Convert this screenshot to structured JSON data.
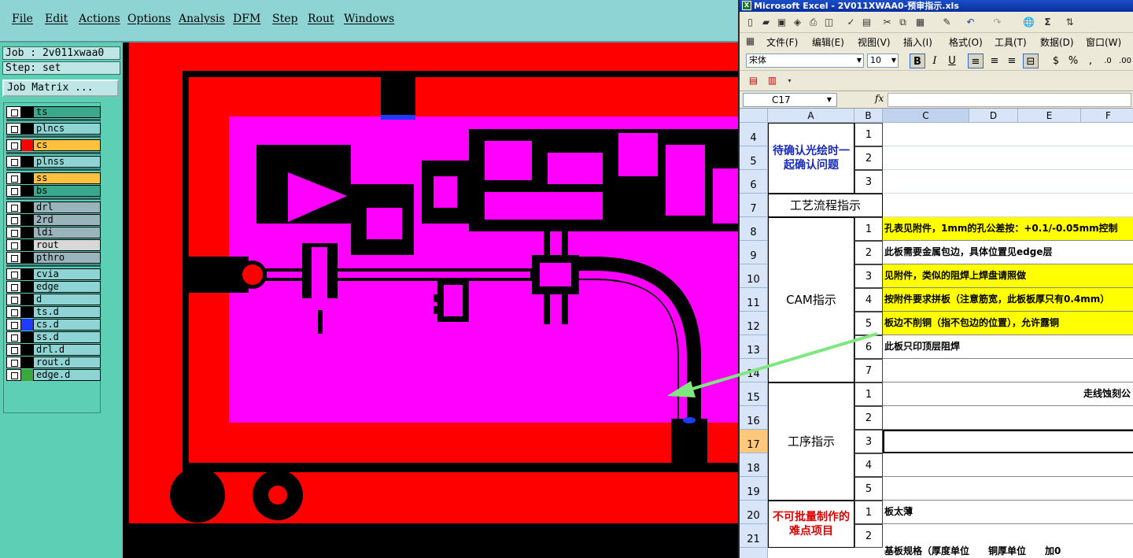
{
  "cam": {
    "menu": [
      "File",
      "Edit",
      "Actions",
      "Options",
      "Analysis",
      "DFM",
      "Step",
      "Rout",
      "Windows"
    ],
    "job_label": "Job : 2v011xwaa0",
    "step_label": "Step: set",
    "job_matrix_button": "Job Matrix ...",
    "layers": [
      {
        "name": "ts",
        "color": "#000000",
        "bg": "#3aa88a"
      },
      {
        "name": "plncs",
        "color": "#000000",
        "bg": "#8fd4d4"
      },
      {
        "name": "cs",
        "color": "#ff0000",
        "bg": "#ffc040"
      },
      {
        "name": "plnss",
        "color": "#000000",
        "bg": "#8fd4d4"
      },
      {
        "name": "ss",
        "color": "#000000",
        "bg": "#ffc040"
      },
      {
        "name": "bs",
        "color": "#000000",
        "bg": "#3aa88a"
      },
      {
        "name": "drl",
        "color": "#000000",
        "bg": "#9ab4bc"
      },
      {
        "name": "2rd",
        "color": "#000000",
        "bg": "#9ab4bc"
      },
      {
        "name": "ldi",
        "color": "#000000",
        "bg": "#9ab4bc"
      },
      {
        "name": "rout",
        "color": "#000000",
        "bg": "#d8d8d8"
      },
      {
        "name": "pthro",
        "color": "#000000",
        "bg": "#9ab4bc"
      },
      {
        "name": "cvia",
        "color": "#000000",
        "bg": "#8fd4d4"
      },
      {
        "name": "edge",
        "color": "#000000",
        "bg": "#8fd4d4"
      },
      {
        "name": "d",
        "color": "#000000",
        "bg": "#8fd4d4"
      },
      {
        "name": "ts.d",
        "color": "#000000",
        "bg": "#8fd4d4"
      },
      {
        "name": "cs.d",
        "color": "#1e3cff",
        "bg": "#8fd4d4"
      },
      {
        "name": "ss.d",
        "color": "#000000",
        "bg": "#8fd4d4"
      },
      {
        "name": "drl.d",
        "color": "#000000",
        "bg": "#8fd4d4"
      },
      {
        "name": "rout.d",
        "color": "#000000",
        "bg": "#8fd4d4"
      },
      {
        "name": "edge.d",
        "color": "#3aa83a",
        "bg": "#8fd4d4"
      }
    ]
  },
  "excel": {
    "title": "Microsoft Excel - 2V011XWAA0-预审指示.xls",
    "menu": [
      "文件(F)",
      "编辑(E)",
      "视图(V)",
      "插入(I)",
      "格式(O)",
      "工具(T)",
      "数据(D)",
      "窗口(W)"
    ],
    "font_name": "宋体",
    "font_size": "10",
    "name_box": "C17",
    "fx": "fx",
    "columns": [
      "A",
      "B",
      "C",
      "D",
      "E",
      "F"
    ],
    "rows": [
      "4",
      "5",
      "6",
      "7",
      "8",
      "9",
      "10",
      "11",
      "12",
      "13",
      "14",
      "15",
      "16",
      "17",
      "18",
      "19",
      "20",
      "21"
    ],
    "sections": {
      "confirm": "待确认光绘时一起确认问题",
      "process_flow": "工艺流程指示",
      "cam": "CAM指示",
      "procedure": "工序指示",
      "difficult": "不可批量制作的难点项目"
    },
    "confirm_nums": [
      "1",
      "2",
      "3"
    ],
    "cam_items": [
      {
        "n": "1",
        "text": "孔表见附件，1mm的孔公差按：+0.1/-0.05mm控制",
        "yellow": true
      },
      {
        "n": "2",
        "text": "此板需要金属包边，具体位置见edge层",
        "yellow": false
      },
      {
        "n": "3",
        "text": "见附件，类似的阻焊上焊盘请照做",
        "yellow": true
      },
      {
        "n": "4",
        "text": "按附件要求拼板（注意筋宽，此板板厚只有0.4mm）",
        "yellow": true
      },
      {
        "n": "5",
        "text": "板边不削铜（指不包边的位置），允许露铜",
        "yellow": true
      },
      {
        "n": "6",
        "text": "此板只印顶层阻焊",
        "yellow": false
      },
      {
        "n": "7",
        "text": "",
        "yellow": false
      }
    ],
    "procedure_items": [
      {
        "n": "1",
        "text": "走线蚀刻公"
      },
      {
        "n": "2",
        "text": ""
      },
      {
        "n": "3",
        "text": ""
      },
      {
        "n": "4",
        "text": ""
      },
      {
        "n": "5",
        "text": ""
      }
    ],
    "difficult_items": [
      {
        "n": "1",
        "text": "板太薄"
      },
      {
        "n": "2",
        "text": ""
      }
    ],
    "partial_bottom": "基板规格（厚度单位　　铜厚单位　　加0"
  },
  "colors": {
    "copper": "#ff0000",
    "soldermask": "#ff00ff",
    "drill": "#1e3cff",
    "arrow": "#7ee87e"
  }
}
